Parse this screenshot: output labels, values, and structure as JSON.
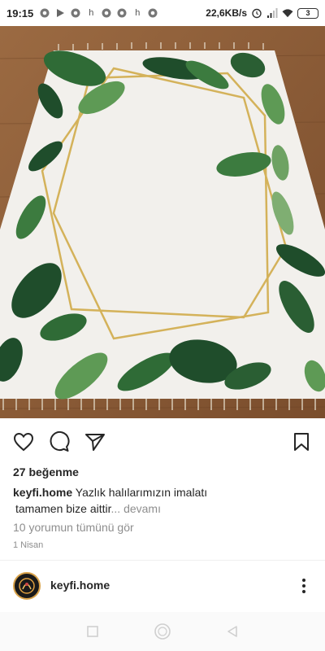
{
  "status_bar": {
    "time": "19:15",
    "left_icons": [
      "chrome-icon",
      "play-store-icon",
      "chrome-icon",
      "h-icon",
      "chrome-icon",
      "chrome-icon",
      "h-icon",
      "chrome-icon"
    ],
    "h_label": "h",
    "network_speed": "22,6KB/s",
    "battery_level": "3",
    "right_icons": [
      "alarm-icon",
      "signal-icon",
      "wifi-icon",
      "battery-icon"
    ]
  },
  "post": {
    "image_alt_icon": "rug-photo",
    "likes": "27 beğenme",
    "username": "keyfi.home",
    "caption_line1": "Yazlık halılarımızın imalatı",
    "caption_line2": "tamamen bize aittir",
    "caption_ellipsis": "...",
    "caption_more": "devamı",
    "view_comments": "10 yorumun tümünü gör",
    "date": "1 Nisan"
  },
  "next_post": {
    "username": "keyfi.home"
  },
  "colors": {
    "text": "#262626",
    "muted": "#8e8e8e",
    "floor": "#8a5c38",
    "rug": "#f2f0ec",
    "gold": "#d4b25a",
    "leaf_dark": "#1f4d2b",
    "leaf_light": "#4f8a4a"
  }
}
